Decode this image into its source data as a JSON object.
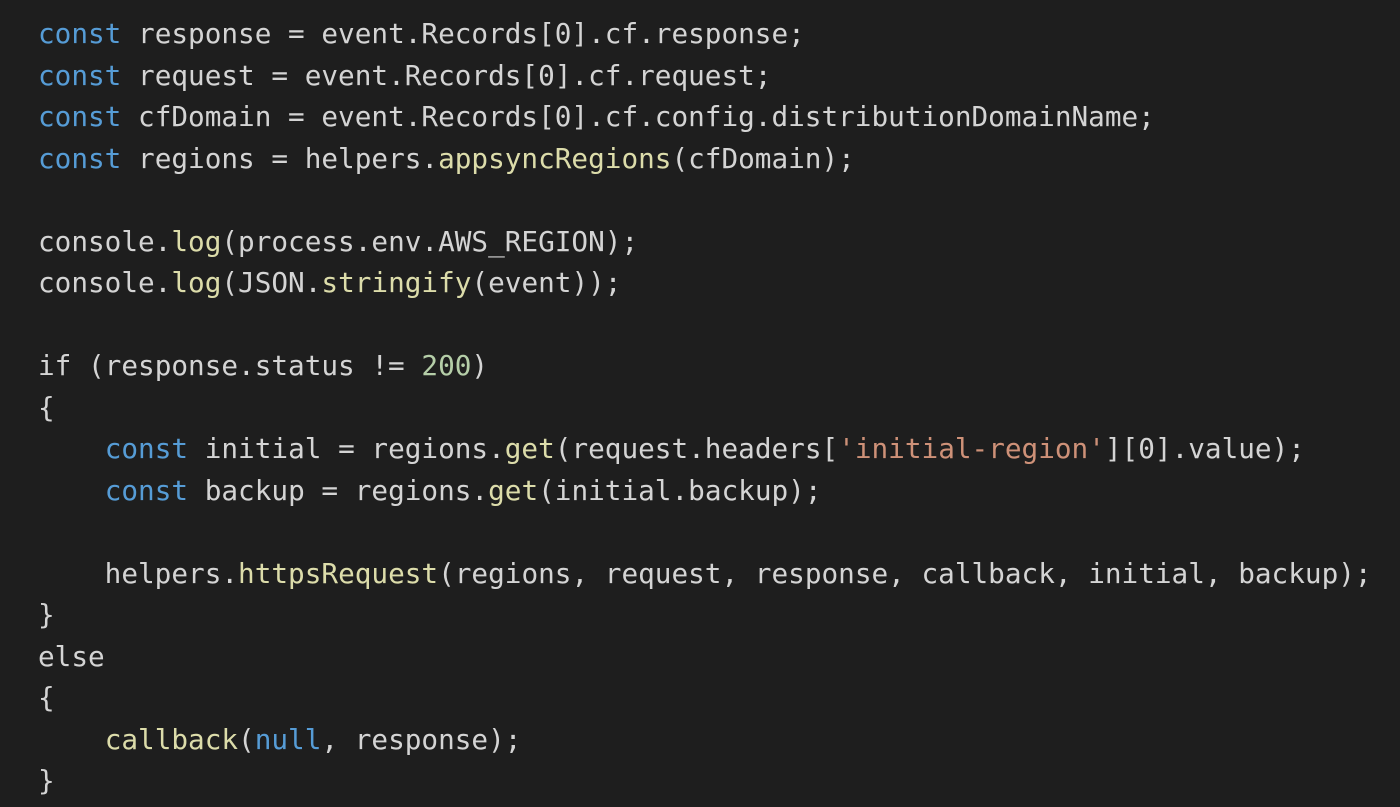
{
  "editor": {
    "theme": {
      "background": "#1e1e1e",
      "default": "#d4d4d4",
      "keyword": "#569cd6",
      "function": "#dcdcaa",
      "string": "#ce9178",
      "number": "#b5cea8"
    },
    "lines": [
      [
        {
          "t": "const",
          "c": "kw"
        },
        {
          "t": " response = event.Records[0].cf.response;",
          "c": "plain"
        }
      ],
      [
        {
          "t": "const",
          "c": "kw"
        },
        {
          "t": " request = event.Records[0].cf.request;",
          "c": "plain"
        }
      ],
      [
        {
          "t": "const",
          "c": "kw"
        },
        {
          "t": " cfDomain = event.Records[0].cf.config.distributionDomainName;",
          "c": "plain"
        }
      ],
      [
        {
          "t": "const",
          "c": "kw"
        },
        {
          "t": " regions = helpers.",
          "c": "plain"
        },
        {
          "t": "appsyncRegions",
          "c": "fn"
        },
        {
          "t": "(cfDomain);",
          "c": "plain"
        }
      ],
      [],
      [
        {
          "t": "console.",
          "c": "plain"
        },
        {
          "t": "log",
          "c": "fn"
        },
        {
          "t": "(process.env.AWS_REGION);",
          "c": "plain"
        }
      ],
      [
        {
          "t": "console.",
          "c": "plain"
        },
        {
          "t": "log",
          "c": "fn"
        },
        {
          "t": "(JSON.",
          "c": "plain"
        },
        {
          "t": "stringify",
          "c": "fn"
        },
        {
          "t": "(event));",
          "c": "plain"
        }
      ],
      [],
      [
        {
          "t": "if",
          "c": "plain"
        },
        {
          "t": " (response.status != ",
          "c": "plain"
        },
        {
          "t": "200",
          "c": "num"
        },
        {
          "t": ")",
          "c": "plain"
        }
      ],
      [
        {
          "t": "{",
          "c": "plain"
        }
      ],
      [
        {
          "t": "    ",
          "c": "plain"
        },
        {
          "t": "const",
          "c": "kw"
        },
        {
          "t": " initial = regions.",
          "c": "plain"
        },
        {
          "t": "get",
          "c": "fn"
        },
        {
          "t": "(request.headers[",
          "c": "plain"
        },
        {
          "t": "'initial-region'",
          "c": "str"
        },
        {
          "t": "][0].value);",
          "c": "plain"
        }
      ],
      [
        {
          "t": "    ",
          "c": "plain"
        },
        {
          "t": "const",
          "c": "kw"
        },
        {
          "t": " backup = regions.",
          "c": "plain"
        },
        {
          "t": "get",
          "c": "fn"
        },
        {
          "t": "(initial.backup);",
          "c": "plain"
        }
      ],
      [],
      [
        {
          "t": "    helpers.",
          "c": "plain"
        },
        {
          "t": "httpsRequest",
          "c": "fn"
        },
        {
          "t": "(regions, request, response, callback, initial, backup);",
          "c": "plain"
        }
      ],
      [
        {
          "t": "}",
          "c": "plain"
        }
      ],
      [
        {
          "t": "else",
          "c": "plain"
        }
      ],
      [
        {
          "t": "{",
          "c": "plain"
        }
      ],
      [
        {
          "t": "    ",
          "c": "plain"
        },
        {
          "t": "callback",
          "c": "fn"
        },
        {
          "t": "(",
          "c": "plain"
        },
        {
          "t": "null",
          "c": "kw"
        },
        {
          "t": ", response);",
          "c": "plain"
        }
      ],
      [
        {
          "t": "}",
          "c": "plain"
        }
      ]
    ]
  }
}
